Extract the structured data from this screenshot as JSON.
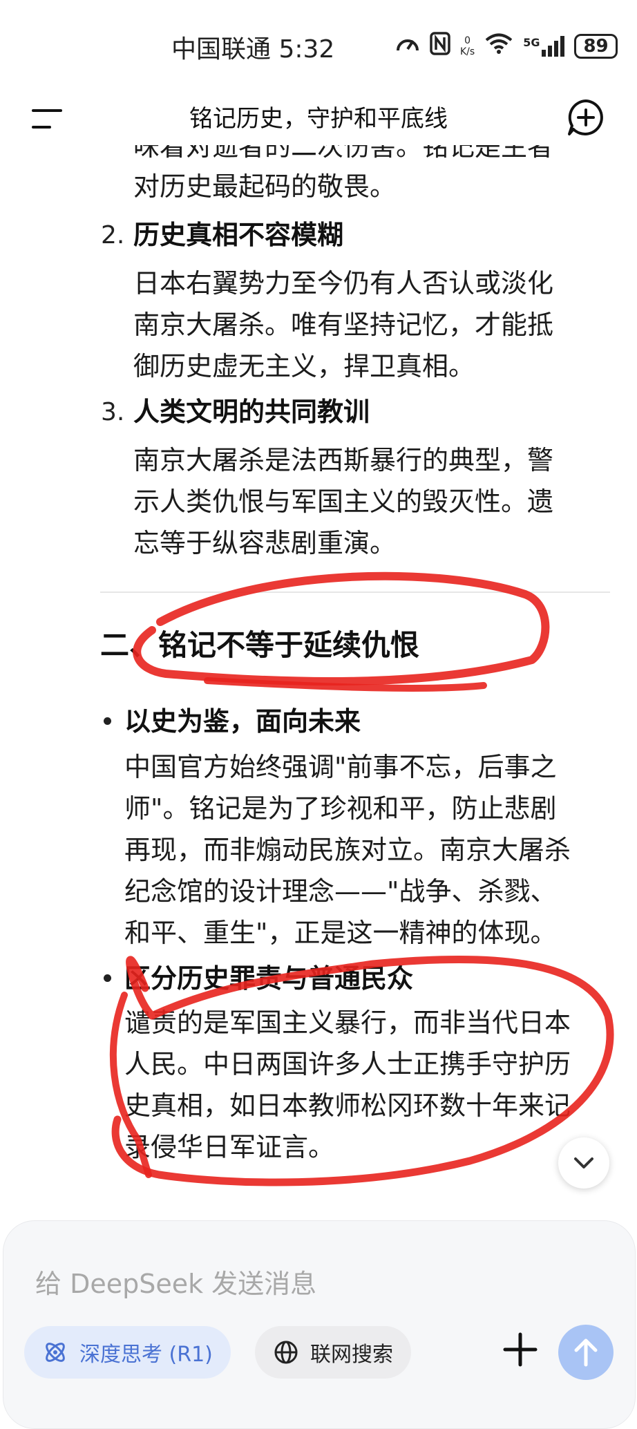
{
  "status_bar": {
    "carrier_time": "中国联通 5:32",
    "net_speed_value": "0",
    "net_speed_unit": "K/s",
    "signal_label": "5G",
    "battery": "89"
  },
  "header": {
    "title": "铭记历史，守护和平底线"
  },
  "article": {
    "partial_line": "味着对逝者的二次伤害。铭记是生者",
    "intro_line": "对历史最起码的敬畏。",
    "items": [
      {
        "number": "2.",
        "title": "历史真相不容模糊",
        "lines": [
          "日本右翼势力至今仍有人否认或淡化",
          "南京大屠杀。唯有坚持记忆，才能抵",
          "御历史虚无主义，捍卫真相。"
        ]
      },
      {
        "number": "3.",
        "title": "人类文明的共同教训",
        "lines": [
          "南京大屠杀是法西斯暴行的典型，警",
          "示人类仇恨与军国主义的毁灭性。遗",
          "忘等于纵容悲剧重演。"
        ]
      }
    ],
    "section_title": "二、铭记不等于延续仇恨",
    "bullets": [
      {
        "title": "以史为鉴，面向未来",
        "lines": [
          "中国官方始终强调\"前事不忘，后事之",
          "师\"。铭记是为了珍视和平，防止悲剧",
          "再现，而非煽动民族对立。南京大屠杀",
          "纪念馆的设计理念——\"战争、杀戮、",
          "和平、重生\"，正是这一精神的体现。"
        ]
      },
      {
        "title": "区分历史罪责与普通民众",
        "lines": [
          "谴责的是军国主义暴行，而非当代日本",
          "人民。中日两国许多人士正携手守护历",
          "史真相，如日本教师松冈环数十年来记",
          "录侵华日军证言。"
        ]
      }
    ]
  },
  "composer": {
    "placeholder": "给 DeepSeek 发送消息",
    "deep_think_label": "深度思考 (R1)",
    "web_search_label": "联网搜索"
  },
  "colors": {
    "annotation_red": "#e8231e",
    "accent_blue": "#4a72d3",
    "send_button": "#a9c4f5"
  }
}
